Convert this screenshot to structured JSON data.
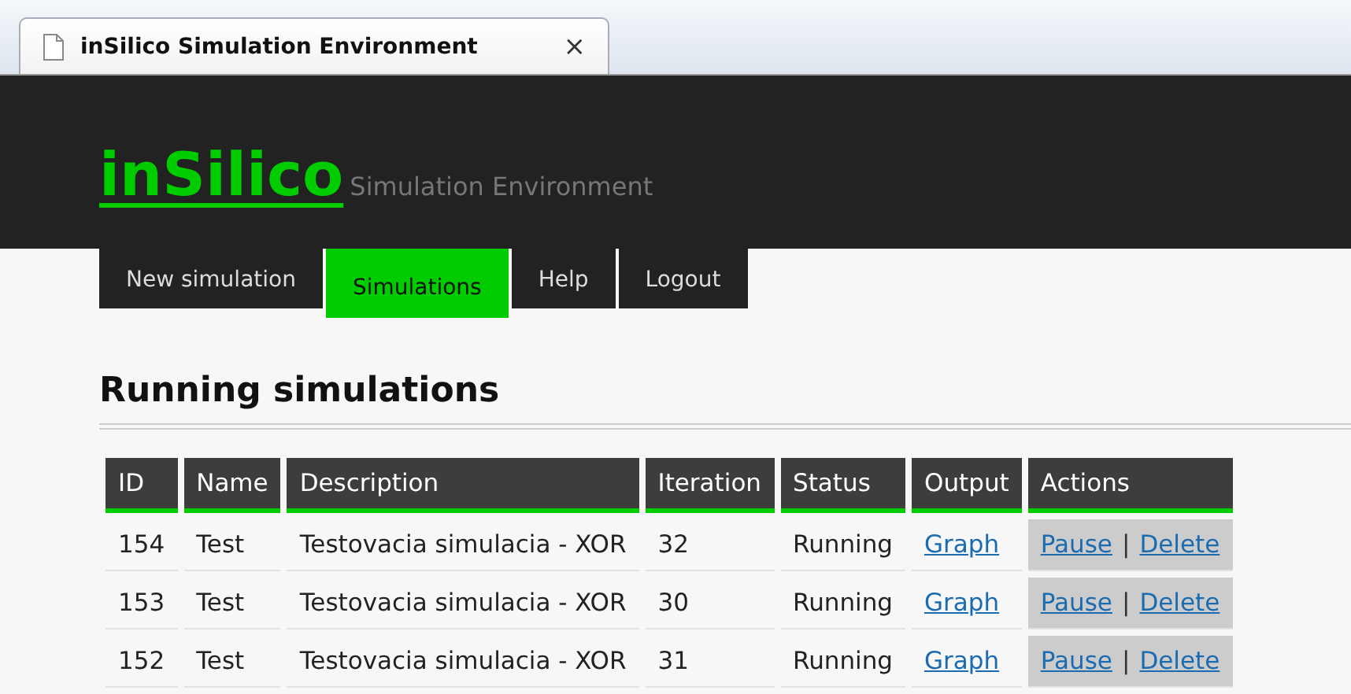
{
  "browser_tab": {
    "title": "inSilico Simulation Environment",
    "close": "×"
  },
  "header": {
    "logo": "inSilico",
    "subtitle": "Simulation Environment"
  },
  "nav": [
    {
      "label": "New simulation",
      "selected": false
    },
    {
      "label": "Simulations",
      "selected": true
    },
    {
      "label": "Help",
      "selected": false
    },
    {
      "label": "Logout",
      "selected": false
    }
  ],
  "heading": "Running simulations",
  "table": {
    "columns": [
      "ID",
      "Name",
      "Description",
      "Iteration",
      "Status",
      "Output",
      "Actions"
    ],
    "rows": [
      {
        "id": "154",
        "name": "Test",
        "description": "Testovacia simulacia - XOR",
        "iteration": "32",
        "status": "Running",
        "output": "Graph",
        "actions": [
          "Pause",
          "Delete"
        ],
        "separator": "|"
      },
      {
        "id": "153",
        "name": "Test",
        "description": "Testovacia simulacia - XOR",
        "iteration": "30",
        "status": "Running",
        "output": "Graph",
        "actions": [
          "Pause",
          "Delete"
        ],
        "separator": "|"
      },
      {
        "id": "152",
        "name": "Test",
        "description": "Testovacia simulacia - XOR",
        "iteration": "31",
        "status": "Running",
        "output": "Graph",
        "actions": [
          "Pause",
          "Delete"
        ],
        "separator": "|"
      }
    ]
  }
}
